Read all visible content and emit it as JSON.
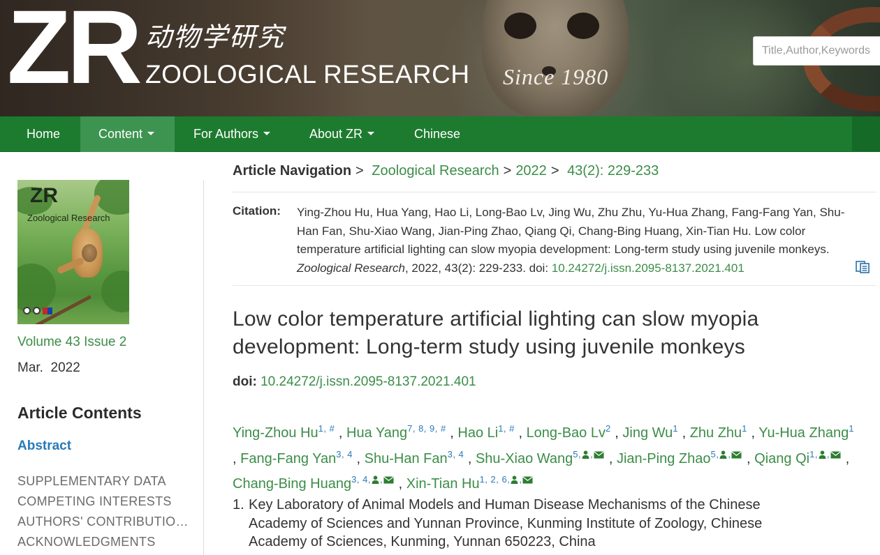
{
  "header": {
    "logo_letters": "ZR",
    "logo_chinese": "动物学研究",
    "logo_english": "ZOOLOGICAL RESEARCH",
    "since": "Since 1980",
    "search_placeholder": "Title,Author,Keywords"
  },
  "nav": {
    "items": [
      {
        "label": "Home",
        "dropdown": false
      },
      {
        "label": "Content",
        "dropdown": true,
        "active": true
      },
      {
        "label": "For Authors",
        "dropdown": true
      },
      {
        "label": "About ZR",
        "dropdown": true
      },
      {
        "label": "Chinese",
        "dropdown": false
      }
    ]
  },
  "sidebar": {
    "cover": {
      "zr": "ZR",
      "title": "Zoological Research"
    },
    "volume_issue": "Volume 43 Issue 2",
    "date": "Mar.  2022",
    "contents_title": "Article Contents",
    "abstract_link": "Abstract",
    "sections": [
      "SUPPLEMENTARY DATA",
      "COMPETING INTERESTS",
      "AUTHORS' CONTRIBUTIONS",
      "ACKNOWLEDGMENTS"
    ]
  },
  "breadcrumb": {
    "label": "Article Navigation",
    "sep": ">",
    "journal": "Zoological Research",
    "year": "2022",
    "issue": "43(2): 229-233"
  },
  "citation": {
    "label": "Citation:",
    "authors_text": "Ying-Zhou Hu, Hua Yang, Hao Li, Long-Bao Lv, Jing Wu, Zhu Zhu, Yu-Hua Zhang, Fang-Fang Yan, Shu-Han Fan, Shu-Xiao Wang, Jian-Ping Zhao, Qiang Qi, Chang-Bing Huang, Xin-Tian Hu. Low color temperature artificial lighting can slow myopia development: Long-term study using juvenile monkeys.",
    "journal": "Zoological Research",
    "details": ", 2022, 43(2): 229-233. doi: ",
    "doi": "10.24272/j.issn.2095-8137.2021.401"
  },
  "article": {
    "title": "Low color temperature artificial lighting can slow myopia development: Long-term study using juvenile monkeys",
    "doi_label": "doi:",
    "doi": "10.24272/j.issn.2095-8137.2021.401"
  },
  "authors": [
    {
      "name": "Ying-Zhou Hu",
      "sup": "1, #",
      "corresponding": false
    },
    {
      "name": "Hua Yang",
      "sup": "7, 8, 9, #",
      "corresponding": false
    },
    {
      "name": "Hao Li",
      "sup": "1, #",
      "corresponding": false
    },
    {
      "name": "Long-Bao Lv",
      "sup": "2",
      "corresponding": false
    },
    {
      "name": "Jing Wu",
      "sup": "1",
      "corresponding": false
    },
    {
      "name": "Zhu Zhu",
      "sup": "1",
      "corresponding": false
    },
    {
      "name": "Yu-Hua Zhang",
      "sup": "1",
      "corresponding": false
    },
    {
      "name": "Fang-Fang Yan",
      "sup": "3, 4",
      "corresponding": false
    },
    {
      "name": "Shu-Han Fan",
      "sup": "3, 4",
      "corresponding": false
    },
    {
      "name": "Shu-Xiao Wang",
      "sup": "5",
      "corresponding": true
    },
    {
      "name": "Jian-Ping Zhao",
      "sup": "5",
      "corresponding": true
    },
    {
      "name": "Qiang Qi",
      "sup": "1",
      "corresponding": true
    },
    {
      "name": "Chang-Bing Huang",
      "sup": "3, 4",
      "corresponding": true
    },
    {
      "name": "Xin-Tian Hu",
      "sup": "1, 2, 6",
      "corresponding": true
    }
  ],
  "affiliations": [
    {
      "num": "1.",
      "text": "Key Laboratory of Animal Models and Human Disease Mechanisms of the Chinese Academy of Sciences and Yunnan Province, Kunming Institute of Zoology, Chinese Academy of Sciences, Kunming, Yunnan 650223, China"
    }
  ],
  "colors": {
    "nav_green": "#1d7b2f",
    "nav_active": "#3d9450",
    "link_green": "#3c8d48",
    "sup_blue": "#2a7ab8"
  },
  "icons": [
    "copy-citation-icon",
    "person-icon",
    "email-icon",
    "caret-down-icon"
  ]
}
